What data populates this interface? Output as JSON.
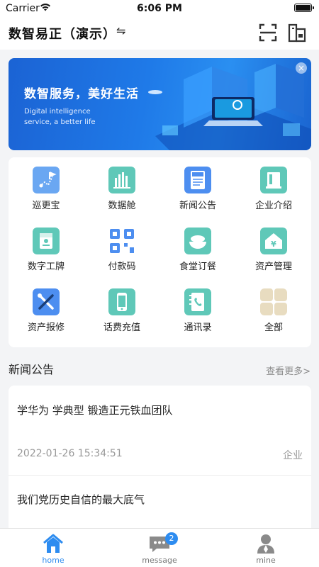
{
  "status_bar": {
    "carrier": "Carrier",
    "time": "6:06 PM"
  },
  "header": {
    "title": "数智易正（演示）",
    "switch_glyph": "⇋"
  },
  "banner": {
    "slogan": "数智服务，美好生活",
    "subtitle_line1": "Digital intelligence",
    "subtitle_line2": "service, a better life",
    "close_glyph": "×"
  },
  "grid": {
    "items": [
      {
        "label": "巡更宝",
        "icon": "patrol-icon",
        "color": "#6aa7f2"
      },
      {
        "label": "数据舱",
        "icon": "data-cabin-icon",
        "color": "#5fc8b8"
      },
      {
        "label": "新闻公告",
        "icon": "news-icon",
        "color": "#4d8ef0"
      },
      {
        "label": "企业介绍",
        "icon": "company-icon",
        "color": "#5fc8b8"
      },
      {
        "label": "数字工牌",
        "icon": "badge-card-icon",
        "color": "#5fc8b8"
      },
      {
        "label": "付款码",
        "icon": "qr-code-icon",
        "color": "#4d8ef0"
      },
      {
        "label": "食堂订餐",
        "icon": "canteen-icon",
        "color": "#5fc8b8"
      },
      {
        "label": "资产管理",
        "icon": "asset-icon",
        "color": "#5fc8b8"
      },
      {
        "label": "资产报修",
        "icon": "repair-icon",
        "color": "#4d8ef0"
      },
      {
        "label": "话费充值",
        "icon": "phone-recharge-icon",
        "color": "#5fc8b8"
      },
      {
        "label": "通讯录",
        "icon": "contacts-icon",
        "color": "#5fc8b8"
      },
      {
        "label": "全部",
        "icon": "all-apps-icon",
        "color": "#e8dcc0"
      }
    ]
  },
  "news": {
    "section_title": "新闻公告",
    "more_label": "查看更多>",
    "items": [
      {
        "headline": "学华为 学典型 锻造正元铁血团队",
        "date": "2022-01-26 15:34:51",
        "category": "企业"
      },
      {
        "headline": "我们党历史自信的最大底气"
      }
    ]
  },
  "tabbar": {
    "tabs": [
      {
        "label": "home",
        "icon": "home-icon"
      },
      {
        "label": "message",
        "icon": "message-icon",
        "badge": "2"
      },
      {
        "label": "mine",
        "icon": "user-icon"
      }
    ],
    "active_color": "#2d8cf0",
    "inactive_color": "#8a8a8a"
  }
}
